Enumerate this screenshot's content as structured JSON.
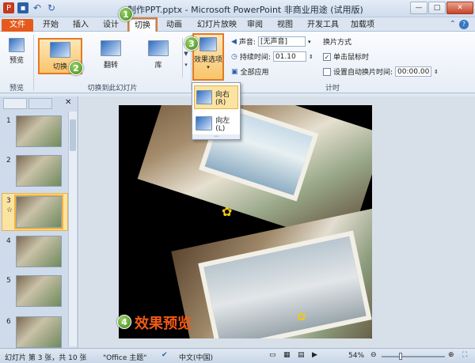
{
  "window": {
    "title": "制作PPT.pptx - Microsoft PowerPoint 非商业用途 (试用版)",
    "min": "—",
    "max": "□",
    "close": "✕"
  },
  "tabs": [
    "文件",
    "开始",
    "插入",
    "设计",
    "切换",
    "动画",
    "幻灯片放映",
    "审阅",
    "视图",
    "开发工具",
    "加载项"
  ],
  "ribbon": {
    "preview": {
      "label": "预览",
      "group": "预览"
    },
    "transitions": {
      "items": [
        {
          "label": "切换"
        },
        {
          "label": "翻转"
        },
        {
          "label": "库"
        }
      ],
      "group": "切换到此幻灯片"
    },
    "effect_options": {
      "label": "效果选项"
    },
    "timing": {
      "sound_label": "声音:",
      "sound_value": "[无声音]",
      "duration_label": "持续时间:",
      "duration_value": "01.10",
      "apply_all": "全部应用",
      "advance_title": "换片方式",
      "on_click": "单击鼠标时",
      "auto_label": "设置自动换片时间:",
      "auto_value": "00:00.00",
      "group": "计时"
    }
  },
  "dropdown": {
    "items": [
      {
        "label": "向右(R)"
      },
      {
        "label": "向左(L)"
      }
    ]
  },
  "thumbnails": [
    {
      "num": "1"
    },
    {
      "num": "2"
    },
    {
      "num": "3",
      "star": "☆"
    },
    {
      "num": "4"
    },
    {
      "num": "5"
    },
    {
      "num": "6"
    }
  ],
  "badges": [
    "1",
    "2",
    "3",
    "4"
  ],
  "slide": {
    "preview_caption": "效果预览"
  },
  "status": {
    "slide_info": "幻灯片 第 3 张，共 10 张",
    "theme": "\"Office 主题\"",
    "language": "中文(中国)",
    "zoom": "54%"
  },
  "colors": {
    "accent": "#e27a26",
    "file_tab": "#e55a1c",
    "badge": "#3d8a1a"
  }
}
